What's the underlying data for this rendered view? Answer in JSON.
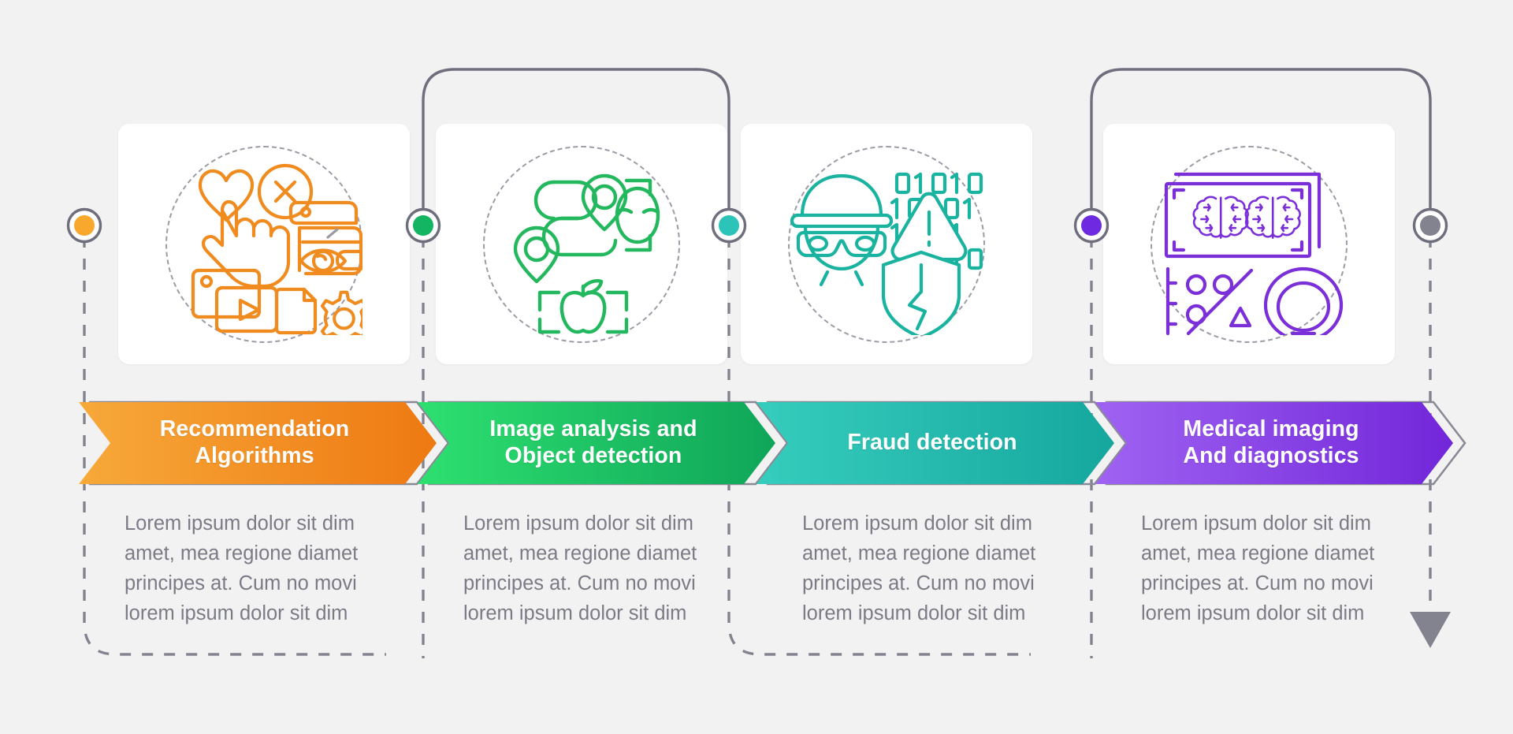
{
  "background_color": "#f2f2f2",
  "chart_data": {
    "type": "table",
    "title": "",
    "layout": "4-step horizontal process infographic with alternating connector routing",
    "steps": [
      {
        "index": 1,
        "label": "Recommendation\nAlgorithms",
        "label_line1": "Recommendation",
        "label_line2": "Algorithms",
        "description": "Lorem ipsum dolor sit dim amet, mea regione diamet principes at. Cum no movi lorem ipsum dolor sit dim",
        "color": "#f6a02a",
        "color_dark": "#ef7d16",
        "dot_color": "#f9a82e",
        "icon": "recommendation-icon",
        "icon_parts": [
          "heart",
          "cursor-hand",
          "x-circle",
          "wallet",
          "eye",
          "media-files",
          "gear",
          "play-button"
        ]
      },
      {
        "index": 2,
        "label": "Image analysis and\nObject detection",
        "label_line1": "Image analysis and",
        "label_line2": "Object detection",
        "description": "Lorem ipsum dolor sit dim amet, mea regione diamet principes at. Cum no movi lorem ipsum dolor sit dim",
        "color": "#2fd96e",
        "color_dark": "#13a95a",
        "dot_color": "#13b462",
        "icon": "image-analysis-icon",
        "icon_parts": [
          "map-route",
          "location-pins",
          "face-scan-bracket",
          "apple-scan-bracket"
        ]
      },
      {
        "index": 3,
        "label": "Fraud detection",
        "label_line1": "Fraud detection",
        "label_line2": "",
        "description": "Lorem ipsum dolor sit dim amet, mea regione diamet principes at. Cum no movi lorem ipsum dolor sit dim",
        "color": "#35c8bb",
        "color_dark": "#17a99f",
        "dot_color": "#2cc3b8",
        "icon": "fraud-detection-icon",
        "icon_parts": [
          "burglar-face-mask",
          "binary-digits",
          "warning-triangle",
          "broken-shield"
        ]
      },
      {
        "index": 4,
        "label": "Medical imaging\nAnd diagnostics",
        "label_line1": "Medical imaging",
        "label_line2": "And diagnostics",
        "description": "Lorem ipsum dolor sit dim amet, mea regione diamet principes at. Cum no movi lorem ipsum dolor sit dim",
        "color": "#9a5bf0",
        "color_dark": "#7429d8",
        "dot_color": "#6d2ae0",
        "icon": "medical-imaging-icon",
        "icon_parts": [
          "brain-scan-frames",
          "scatter-chart",
          "awareness-ribbon"
        ]
      }
    ],
    "end_marker": {
      "type": "down-arrow",
      "color": "#83838f"
    },
    "connector_color": "#83838f"
  },
  "steps_view": {
    "s1": {
      "line1": "Recommendation",
      "line2": "Algorithms",
      "desc": "Lorem ipsum dolor sit dim amet, mea regione diamet principes at. Cum no movi lorem ipsum dolor sit dim"
    },
    "s2": {
      "line1": "Image analysis and",
      "line2": "Object detection",
      "desc": "Lorem ipsum dolor sit dim amet, mea regione diamet principes at. Cum no movi lorem ipsum dolor sit dim"
    },
    "s3": {
      "line1": "Fraud detection",
      "line2": "",
      "desc": "Lorem ipsum dolor sit dim amet, mea regione diamet principes at. Cum no movi lorem ipsum dolor sit dim"
    },
    "s4": {
      "line1": "Medical imaging",
      "line2": "And diagnostics",
      "desc": "Lorem ipsum dolor sit dim amet, mea regione diamet principes at. Cum no movi lorem ipsum dolor sit dim"
    }
  }
}
